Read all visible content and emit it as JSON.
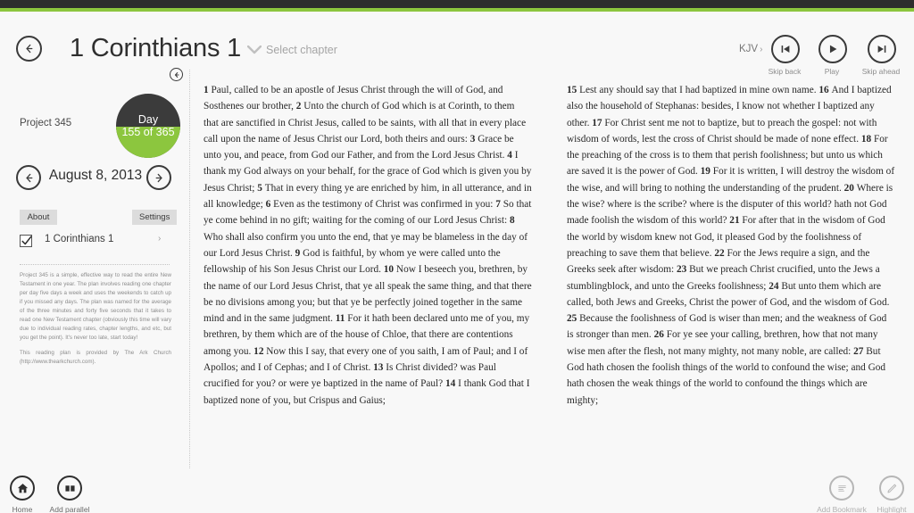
{
  "theme": {
    "accent": "#8cc63e",
    "dark": "#2d2d2d",
    "ring_dark": "#3b3b3b"
  },
  "header": {
    "back_icon": "back-arrow-icon",
    "title": "1 Corinthians 1",
    "caret_icon": "chevron-down-icon",
    "select_chapter": "Select chapter",
    "version": "KJV",
    "version_chevron": "›",
    "media": [
      {
        "id": "skip-back",
        "label": "Skip back",
        "icon": "skip-back-icon"
      },
      {
        "id": "play",
        "label": "Play",
        "icon": "play-icon"
      },
      {
        "id": "skip-ahead",
        "label": "Skip ahead",
        "icon": "skip-ahead-icon"
      }
    ]
  },
  "sidebar": {
    "collapse_icon": "back-arrow-icon",
    "project_name": "Project 345",
    "progress": {
      "word": "Day",
      "value": "155 of 365",
      "current": 155,
      "total": 365,
      "percent": 42
    },
    "date": {
      "prev_icon": "left-arrow-icon",
      "label": "August 8, 2013",
      "next_icon": "right-arrow-icon"
    },
    "buttons": {
      "about": "About",
      "settings": "Settings"
    },
    "chapter_item": {
      "label": "1 Corinthians 1",
      "checked": true,
      "chevron": "›"
    },
    "blurb_1": "Project 345 is a simple, effective way to read the entire New Testament in one year. The plan involves reading one chapter per day five days a week and uses the weekends to catch up if you missed any days. The plan was named for the average of the three minutes and forty five seconds that it takes to read one New Testament chapter (obviously this time will vary due to individual reading rates, chapter lengths, and etc, but you get the point). It's never too late, start today!",
    "blurb_2": "This reading plan is provided by The Ark Church (http://www.thearkchurch.com)."
  },
  "scripture": {
    "book_chapter": "1 Corinthians 1",
    "version": "KJV",
    "column_left": [
      {
        "n": "1",
        "t": "Paul, called to be an apostle of Jesus Christ through the will of God, and Sosthenes our brother,"
      },
      {
        "n": "2",
        "t": "Unto the church of God which is at Corinth, to them that are sanctified in Christ Jesus, called to be saints, with all that in every place call upon the name of Jesus Christ our Lord, both theirs and ours:"
      },
      {
        "n": "3",
        "t": "Grace be unto you, and peace, from God our Father, and from the Lord Jesus Christ."
      },
      {
        "n": "4",
        "t": "I thank my God always on your behalf, for the grace of God which is given you by Jesus Christ;"
      },
      {
        "n": "5",
        "t": "That in every thing ye are enriched by him, in all utterance, and in all knowledge;"
      },
      {
        "n": "6",
        "t": "Even as the testimony of Christ was confirmed in you:"
      },
      {
        "n": "7",
        "t": "So that ye come behind in no gift; waiting for the coming of our Lord Jesus Christ:"
      },
      {
        "n": "8",
        "t": "Who shall also confirm you unto the end, that ye may be blameless in the day of our Lord Jesus Christ."
      },
      {
        "n": "9",
        "t": "God is faithful, by whom ye were called unto the fellowship of his Son Jesus Christ our Lord."
      },
      {
        "n": "10",
        "t": "Now I beseech you, brethren, by the name of our Lord Jesus Christ, that ye all speak the same thing, and that there be no divisions among you; but that ye be perfectly joined together in the same mind and in the same judgment."
      },
      {
        "n": "11",
        "t": "For it hath been declared unto me of you, my brethren, by them which are of the house of Chloe, that there are contentions among you."
      },
      {
        "n": "12",
        "t": "Now this I say, that every one of you saith, I am of Paul; and I of Apollos; and I of Cephas; and I of Christ."
      },
      {
        "n": "13",
        "t": "Is Christ divided? was Paul crucified for you? or were ye baptized in the name of Paul?"
      },
      {
        "n": "14",
        "t": "I thank God that I baptized none of you, but Crispus and Gaius;"
      }
    ],
    "column_right": [
      {
        "n": "15",
        "t": "Lest any should say that I had baptized in mine own name."
      },
      {
        "n": "16",
        "t": "And I baptized also the household of Stephanas: besides, I know not whether I baptized any other."
      },
      {
        "n": "17",
        "t": "For Christ sent me not to baptize, but to preach the gospel: not with wisdom of words, lest the cross of Christ should be made of none effect."
      },
      {
        "n": "18",
        "t": "For the preaching of the cross is to them that perish foolishness; but unto us which are saved it is the power of God."
      },
      {
        "n": "19",
        "t": "For it is written, I will destroy the wisdom of the wise, and will bring to nothing the understanding of the prudent."
      },
      {
        "n": "20",
        "t": "Where is the wise? where is the scribe? where is the disputer of this world? hath not God made foolish the wisdom of this world?"
      },
      {
        "n": "21",
        "t": "For after that in the wisdom of God the world by wisdom knew not God, it pleased God by the foolishness of preaching to save them that believe."
      },
      {
        "n": "22",
        "t": "For the Jews require a sign, and the Greeks seek after wisdom:"
      },
      {
        "n": "23",
        "t": "But we preach Christ crucified, unto the Jews a stumblingblock, and unto the Greeks foolishness;"
      },
      {
        "n": "24",
        "t": "But unto them which are called, both Jews and Greeks, Christ the power of God, and the wisdom of God."
      },
      {
        "n": "25",
        "t": "Because the foolishness of God is wiser than men; and the weakness of God is stronger than men."
      },
      {
        "n": "26",
        "t": "For ye see your calling, brethren, how that not many wise men after the flesh, not many mighty, not many noble, are called:"
      },
      {
        "n": "27",
        "t": "But God hath chosen the foolish things of the world to confound the wise; and God hath chosen the weak things of the world to confound the things which are mighty;"
      }
    ]
  },
  "bottom_bar": {
    "home": {
      "label": "Home",
      "icon": "home-icon"
    },
    "add_parallel": {
      "label": "Add parallel",
      "icon": "add-parallel-icon"
    },
    "add_bookmark": {
      "label": "Add Bookmark",
      "icon": "bookmark-icon"
    },
    "highlight": {
      "label": "Highlight",
      "icon": "pencil-icon"
    }
  }
}
